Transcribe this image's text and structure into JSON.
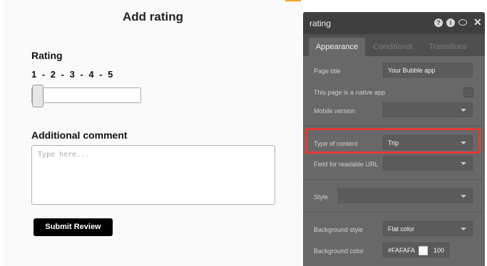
{
  "canvas": {
    "title": "Add rating",
    "rating_label": "Rating",
    "rating_scale": "1 - 2 - 3 - 4 - 5",
    "comment_label": "Additional comment",
    "comment_placeholder": "Type here...",
    "submit_label": "Submit Review"
  },
  "panel": {
    "title": "rating",
    "tabs": [
      {
        "label": "Appearance",
        "active": true
      },
      {
        "label": "Conditional",
        "active": false
      },
      {
        "label": "Transitions",
        "active": false
      }
    ],
    "fields": {
      "page_title": {
        "label": "Page title",
        "value": "Your Bubble app"
      },
      "native_app": {
        "label": "This page is a native app",
        "checked": false
      },
      "mobile_version": {
        "label": "Mobile version",
        "value": ""
      },
      "type_of_content": {
        "label": "Type of content",
        "value": "Trip"
      },
      "readable_url": {
        "label": "Field for readable URL",
        "value": ""
      },
      "style": {
        "label": "Style",
        "value": ""
      },
      "background_style": {
        "label": "Background style",
        "value": "Flat color"
      },
      "background_color": {
        "label": "Background color",
        "hex": "#FAFAFA",
        "opacity": "100"
      }
    }
  },
  "colors": {
    "highlight": "#e53935",
    "panel_bg": "#686868",
    "swatch": "#FAFAFA",
    "accent": "#f5a623"
  },
  "icons": [
    "help-icon",
    "info-icon",
    "comment-icon",
    "close-icon"
  ]
}
